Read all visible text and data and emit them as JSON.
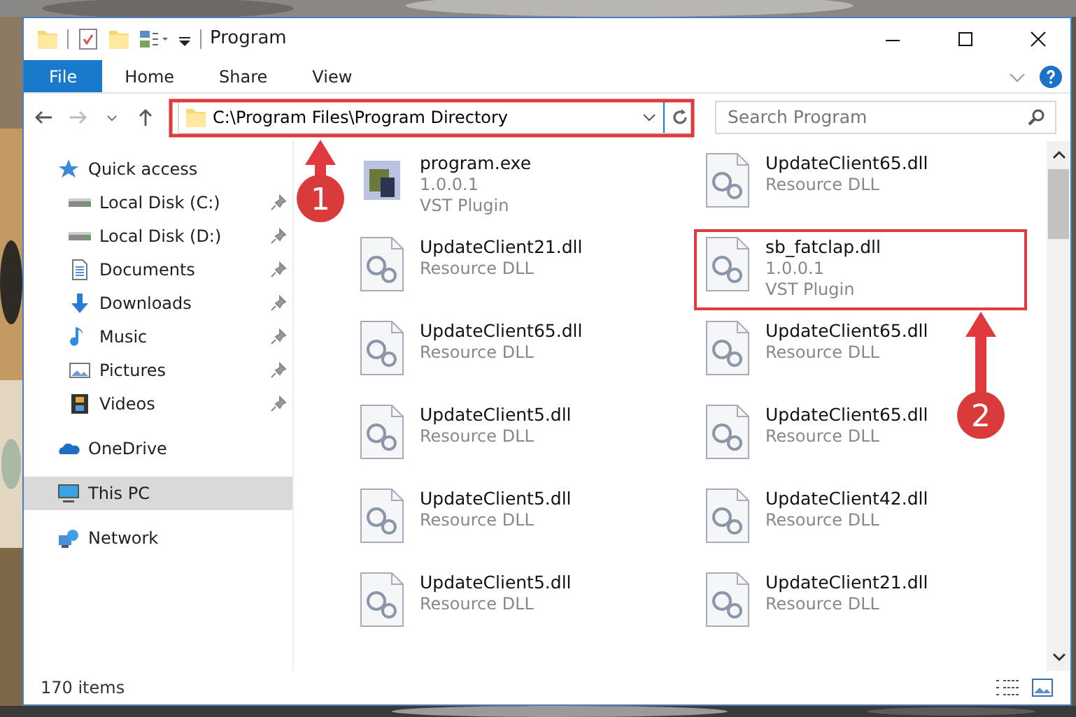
{
  "window": {
    "title": "Program"
  },
  "ribbon_tabs": [
    {
      "label": "File",
      "kind": "file"
    },
    {
      "label": "Home",
      "kind": "tab"
    },
    {
      "label": "Share",
      "kind": "tab"
    },
    {
      "label": "View",
      "kind": "tab"
    }
  ],
  "address": {
    "path": "C:\\Program Files\\Program Directory"
  },
  "search": {
    "placeholder": "Search Program"
  },
  "sidebar": {
    "items": [
      {
        "label": "Quick access",
        "selected": false,
        "children": [
          {
            "label": "Local Disk (C:)",
            "pinned": true,
            "selected": false
          },
          {
            "label": "Local Disk (D:)",
            "pinned": true,
            "selected": false
          },
          {
            "label": "Documents",
            "pinned": true,
            "selected": false
          },
          {
            "label": "Downloads",
            "pinned": true,
            "selected": false
          },
          {
            "label": "Music",
            "pinned": true,
            "selected": false
          },
          {
            "label": "Pictures",
            "pinned": true,
            "selected": false
          },
          {
            "label": "Videos",
            "pinned": true,
            "selected": false
          }
        ]
      },
      {
        "label": "OneDrive",
        "selected": false
      },
      {
        "label": "This PC",
        "selected": true
      },
      {
        "label": "Network",
        "selected": false
      }
    ]
  },
  "files": [
    {
      "name": "program.exe",
      "details": [
        "1.0.0.1",
        "VST Plugin"
      ],
      "kind": "exe",
      "highlighted": false
    },
    {
      "name": "UpdateClient65.dll",
      "details": [
        "Resource DLL"
      ],
      "kind": "dll",
      "highlighted": false
    },
    {
      "name": "UpdateClient21.dll",
      "details": [
        "Resource DLL"
      ],
      "kind": "dll",
      "highlighted": false
    },
    {
      "name": "sb_fatclap.dll",
      "details": [
        "1.0.0.1",
        "VST Plugin"
      ],
      "kind": "dll",
      "highlighted": true
    },
    {
      "name": "UpdateClient65.dll",
      "details": [
        "Resource DLL"
      ],
      "kind": "dll",
      "highlighted": false
    },
    {
      "name": "UpdateClient65.dll",
      "details": [
        "Resource DLL"
      ],
      "kind": "dll",
      "highlighted": false
    },
    {
      "name": "UpdateClient5.dll",
      "details": [
        "Resource DLL"
      ],
      "kind": "dll",
      "highlighted": false
    },
    {
      "name": "UpdateClient65.dll",
      "details": [
        "Resource DLL"
      ],
      "kind": "dll",
      "highlighted": false
    },
    {
      "name": "UpdateClient5.dll",
      "details": [
        "Resource DLL"
      ],
      "kind": "dll",
      "highlighted": false
    },
    {
      "name": "UpdateClient42.dll",
      "details": [
        "Resource DLL"
      ],
      "kind": "dll",
      "highlighted": false
    },
    {
      "name": "UpdateClient5.dll",
      "details": [
        "Resource DLL"
      ],
      "kind": "dll",
      "highlighted": false
    },
    {
      "name": "UpdateClient21.dll",
      "details": [
        "Resource DLL"
      ],
      "kind": "dll",
      "highlighted": false
    }
  ],
  "status_bar": {
    "text": "170 items"
  },
  "annotations": [
    {
      "label": "1"
    },
    {
      "label": "2"
    }
  ]
}
